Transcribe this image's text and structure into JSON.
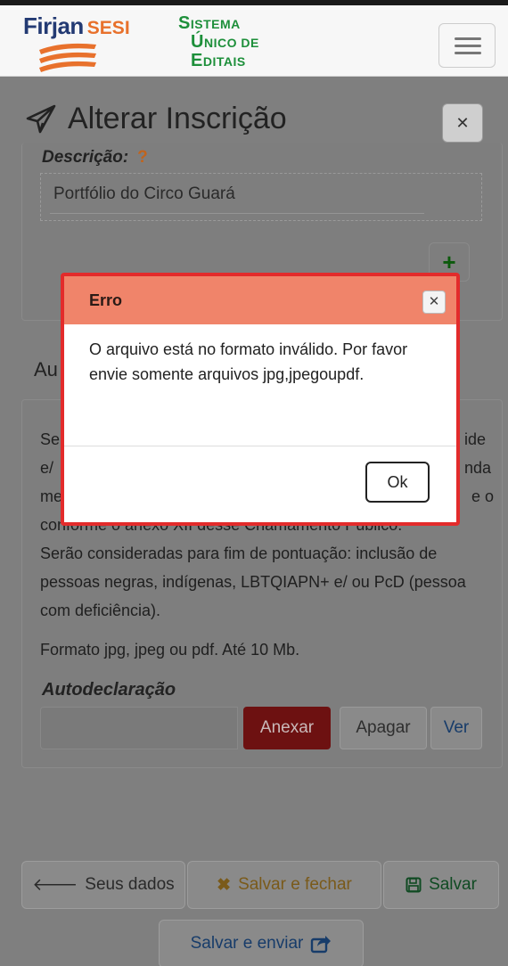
{
  "brand": {
    "firjan": "Firjan",
    "sesi": "SESI",
    "sue_line1": [
      "S",
      "ISTEMA"
    ],
    "sue_line2": [
      "Ú",
      "NICO DE"
    ],
    "sue_line3": [
      "E",
      "DITAIS"
    ]
  },
  "page": {
    "title": "Alterar Inscrição"
  },
  "descricao": {
    "label": "Descrição:",
    "help": "?",
    "value": "Portfólio do Circo Guará"
  },
  "section": {
    "title_visible": "Au",
    "line_left": [
      "Se",
      "e/",
      "me"
    ],
    "line_right": [
      "ide",
      "nda",
      "e o"
    ],
    "line_partial": "conforme o anexo XII desse Chamamento Público.",
    "paragraph_rest": "Serão consideradas para fim de pontuação: inclusão de pessoas negras, indígenas, LBTQIAPN+ e/ ou PcD (pessoa com deficiência).",
    "format_note": "Formato jpg, jpeg ou pdf. Até 10 Mb.",
    "upload_label": "Autodeclaração",
    "anexar": "Anexar",
    "apagar": "Apagar",
    "ver": "Ver"
  },
  "footer": {
    "seus_dados": "Seus dados",
    "salvar_fechar": "Salvar e fechar",
    "salvar": "Salvar",
    "salvar_enviar": "Salvar e enviar"
  },
  "modal": {
    "title": "Erro",
    "message": "O arquivo está no formato inválido. Por favor envie somente arquivos jpg,jpegoupdf.",
    "ok": "Ok"
  },
  "icons": {
    "title": "paper-plane-icon",
    "back": "arrow-left-icon",
    "close": "times-icon",
    "save": "floppy-disk-icon",
    "send": "share-square-icon",
    "add": "plus-icon"
  },
  "colors": {
    "modal_border": "#e32b2b",
    "modal_header": "#f0846a",
    "anexar_bg": "#6d1111",
    "brand_green": "#1d8f3a",
    "brand_orange": "#e8712c",
    "brand_navy": "#233a73"
  }
}
